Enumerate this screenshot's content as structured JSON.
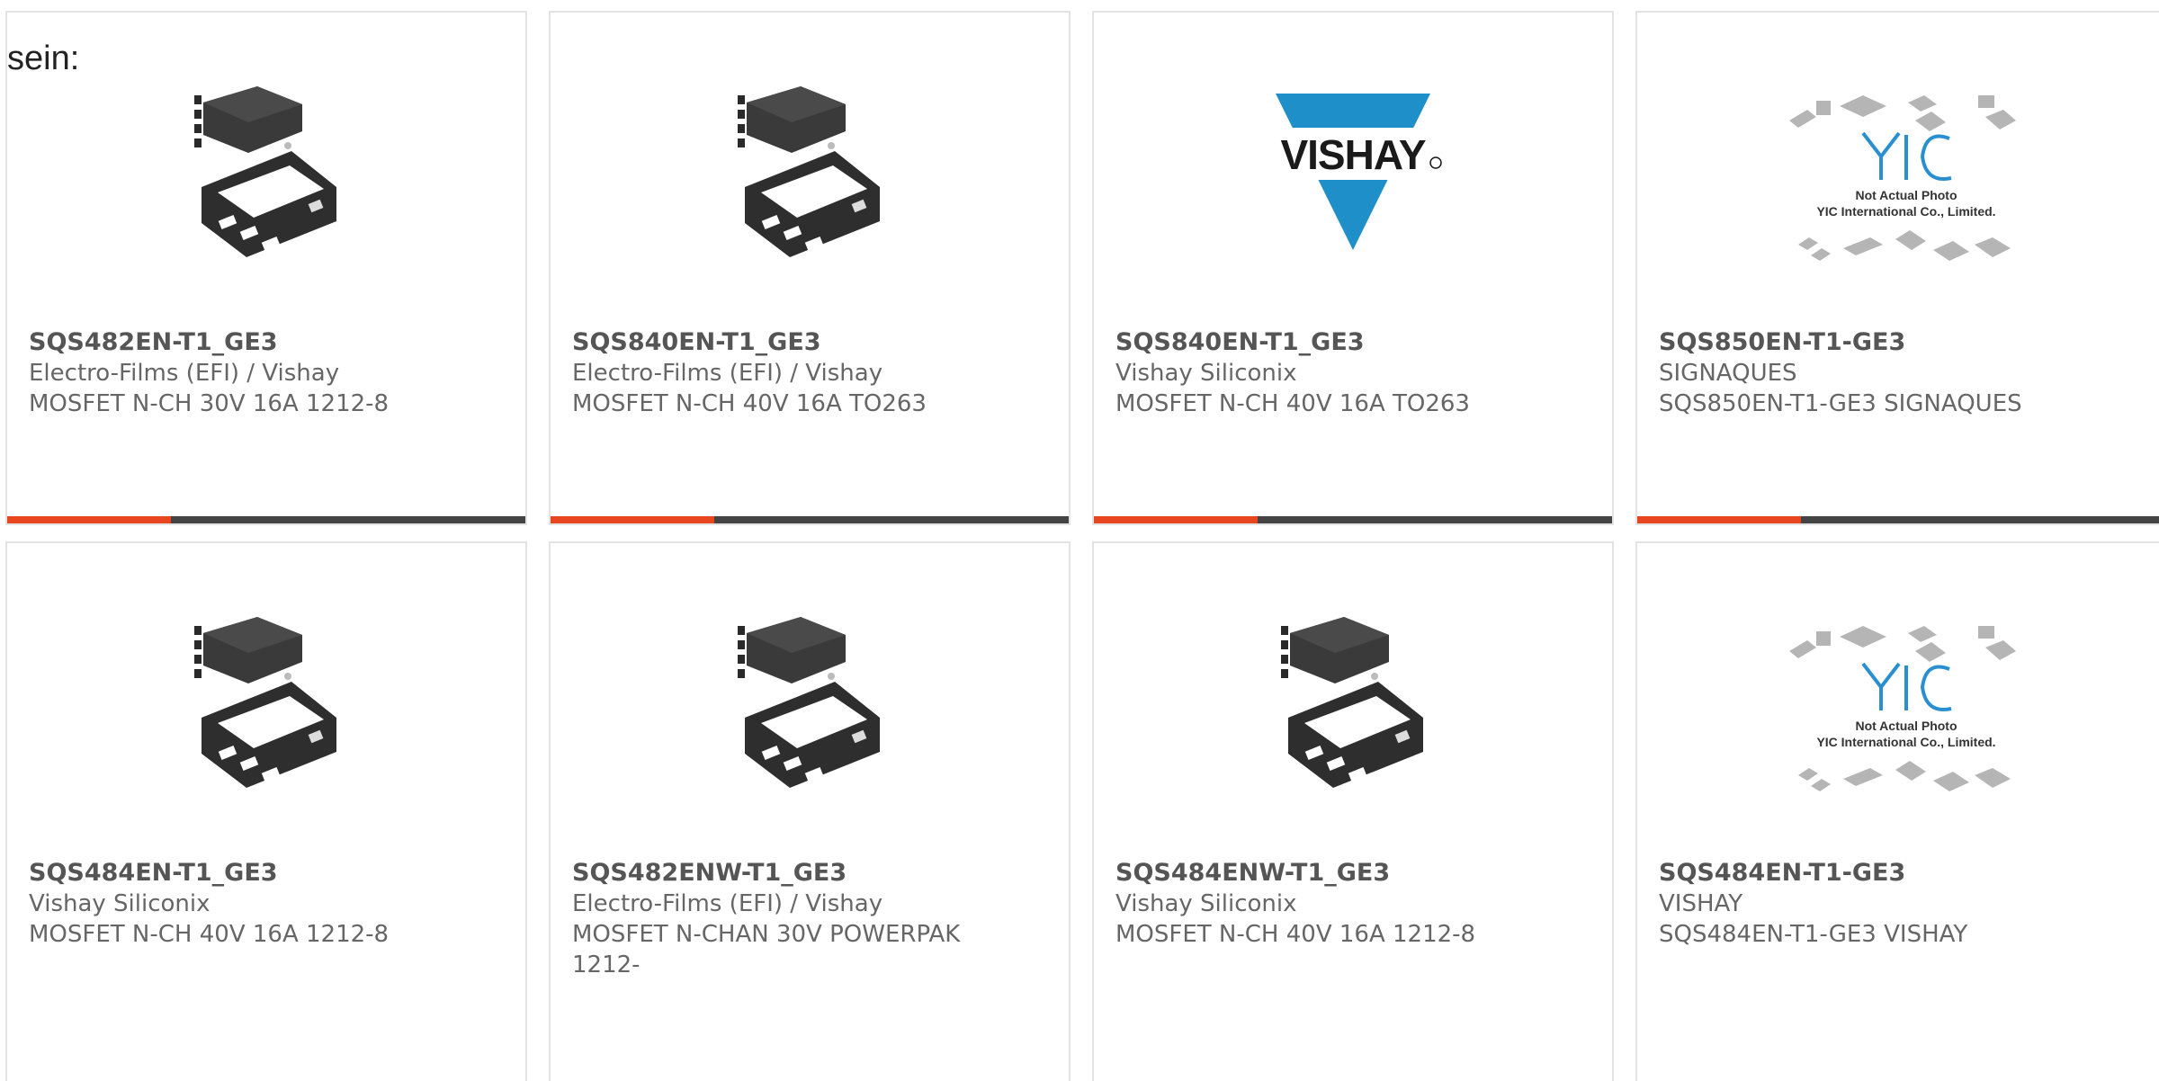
{
  "lead_text": "sein:",
  "brand_colors": {
    "accent": "#e8461e",
    "bar": "#444444",
    "card_border": "#e3e3e3",
    "vishay_blue": "#1e8fc8"
  },
  "products": [
    {
      "part": "SQS482EN-T1_GE3",
      "manufacturer": "Electro-Films (EFI) / Vishay",
      "description": "MOSFET N-CH 30V 16A 1212-8",
      "image": "mosfet-powerpak-photo"
    },
    {
      "part": "SQS840EN-T1_GE3",
      "manufacturer": "Electro-Films (EFI) / Vishay",
      "description": "MOSFET N-CH 40V 16A TO263",
      "image": "mosfet-powerpak-photo"
    },
    {
      "part": "SQS840EN-T1_GE3",
      "manufacturer": "Vishay Siliconix",
      "description": "MOSFET N-CH 40V 16A TO263",
      "image": "vishay-logo",
      "logo_text": "VISHAY"
    },
    {
      "part": "SQS850EN-T1-GE3",
      "manufacturer": "SIGNAQUES",
      "description": "SQS850EN-T1-GE3 SIGNAQUES",
      "image": "yic-placeholder",
      "placeholder_line1": "Not Actual Photo",
      "placeholder_line2": "YIC International Co., Limited."
    },
    {
      "part": "SQS484EN-T1_GE3",
      "manufacturer": "Vishay Siliconix",
      "description": "MOSFET N-CH 40V 16A 1212-8",
      "image": "mosfet-powerpak-photo"
    },
    {
      "part": "SQS482ENW-T1_GE3",
      "manufacturer": "Electro-Films (EFI) / Vishay",
      "description": "MOSFET N-CHAN 30V POWERPAK 1212-",
      "image": "mosfet-powerpak-photo"
    },
    {
      "part": "SQS484ENW-T1_GE3",
      "manufacturer": "Vishay Siliconix",
      "description": "MOSFET N-CH 40V 16A 1212-8",
      "image": "mosfet-powerpak-photo"
    },
    {
      "part": "SQS484EN-T1-GE3",
      "manufacturer": "VISHAY",
      "description": "SQS484EN-T1-GE3 VISHAY",
      "image": "yic-placeholder",
      "placeholder_line1": "Not Actual Photo",
      "placeholder_line2": "YIC International Co., Limited."
    }
  ]
}
